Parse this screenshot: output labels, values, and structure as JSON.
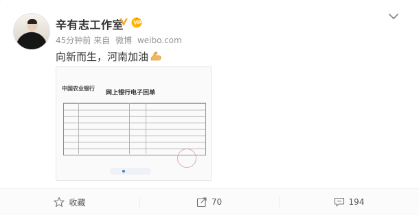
{
  "post": {
    "author_name": "辛有志工作室",
    "verified_badge": "v-verified-icon",
    "vip_badge": "vip-member-icon",
    "time": "45分钟前",
    "source_prefix": "来自",
    "source_app": "微博",
    "source_site": "weibo.com",
    "text": "向新而生，河南加油",
    "emoji": "flexed-biceps-icon",
    "image": {
      "bank_name": "中国农业银行",
      "title": "网上银行电子回单"
    }
  },
  "actions": {
    "favorite_label": "收藏",
    "repost_count": "70",
    "comment_count": "194"
  },
  "colors": {
    "accent": "#f5a623",
    "verified_blue": "#1a9de4",
    "text_gray": "#939393"
  }
}
